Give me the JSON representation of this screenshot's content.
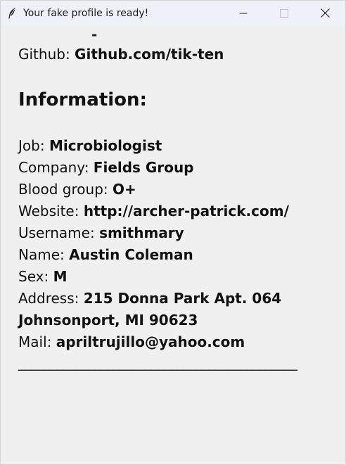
{
  "window": {
    "title": "Your fake profile is ready!",
    "app_icon": "feather-icon",
    "controls": [
      "minimize-icon",
      "maximize-icon",
      "close-icon"
    ]
  },
  "profile": {
    "cutoff_text": "-",
    "github": {
      "label": "Github: ",
      "value": "Github.com/tik-ten"
    },
    "information_heading": "Information:",
    "job": {
      "label": "Job: ",
      "value": "Microbiologist"
    },
    "company": {
      "label": "Company: ",
      "value": "Fields Group"
    },
    "blood_group": {
      "label": "Blood group: ",
      "value": "O+"
    },
    "website": {
      "label": "Website: ",
      "value": "http://archer-patrick.com/"
    },
    "username": {
      "label": "Username: ",
      "value": "smithmary"
    },
    "name": {
      "label": "Name: ",
      "value": "Austin Coleman"
    },
    "sex": {
      "label": "Sex: ",
      "value": "M"
    },
    "address": {
      "label": "Address: ",
      "line1": "215 Donna Park Apt. 064",
      "line2": "Johnsonport, MI 90623"
    },
    "mail": {
      "label": "Mail: ",
      "value": "apriltrujillo@yahoo.com"
    },
    "divider": "____________________________________________"
  }
}
